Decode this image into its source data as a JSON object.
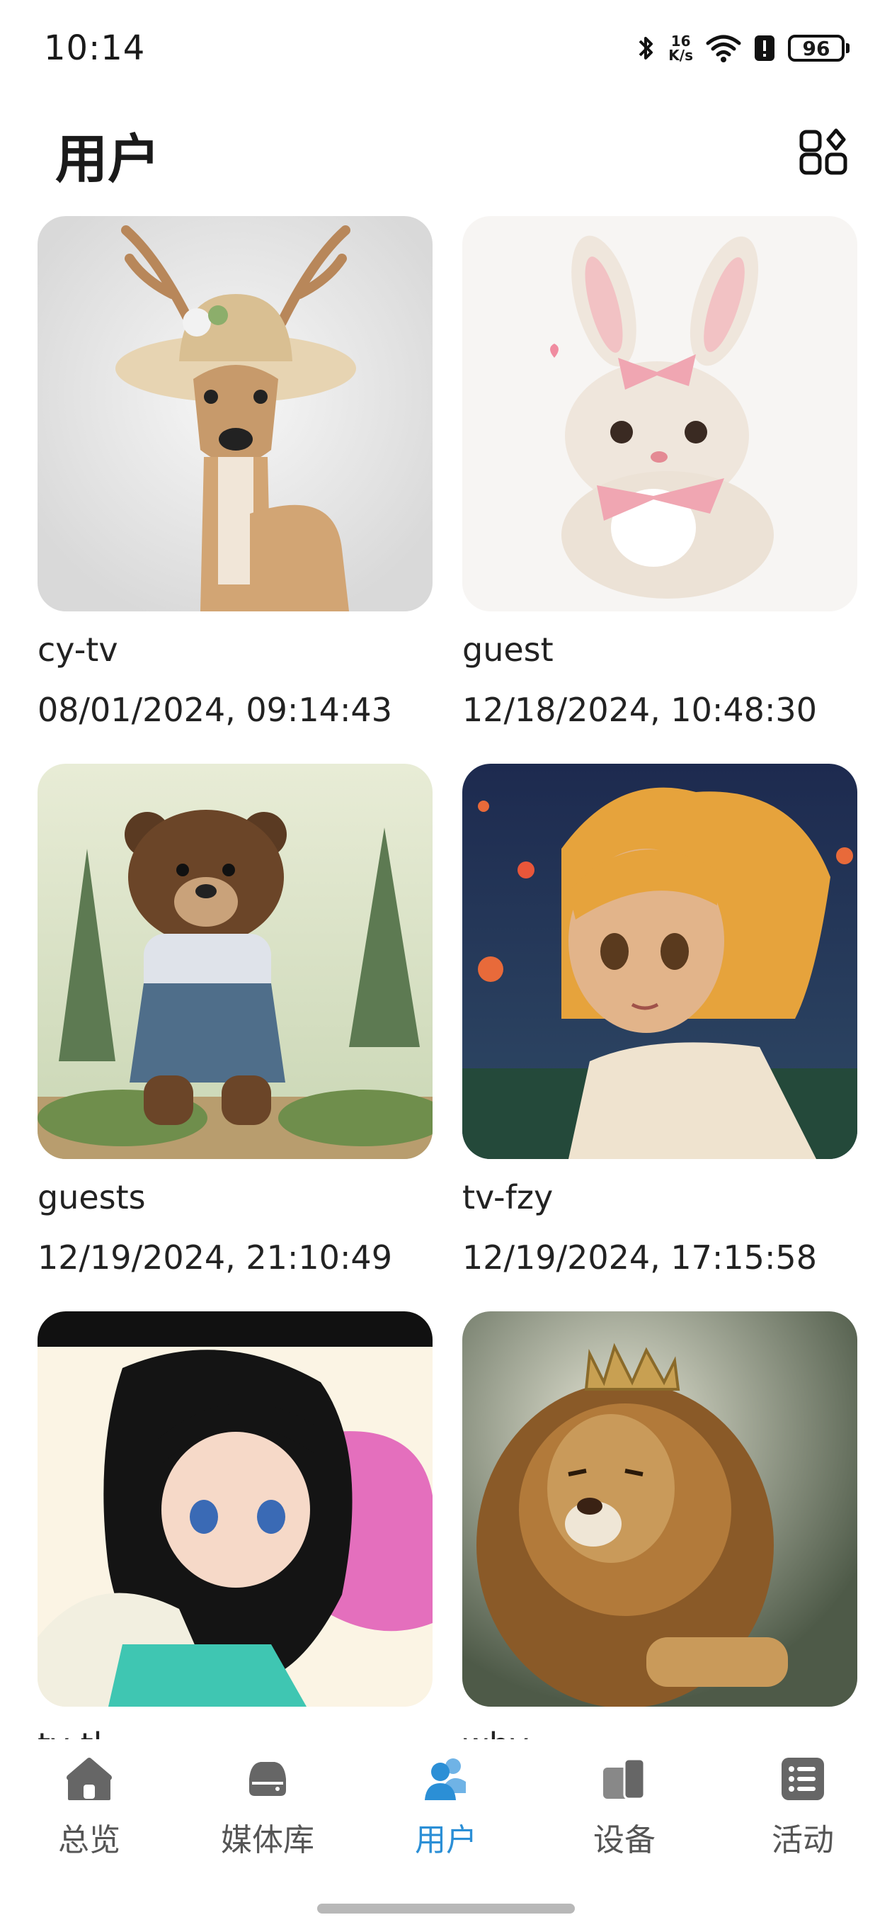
{
  "status_bar": {
    "time": "10:14",
    "speed_value": "16",
    "speed_unit": "K/s",
    "battery": "96"
  },
  "header": {
    "title": "用户"
  },
  "users": [
    {
      "name": "cy-tv",
      "last_seen": "08/01/2024, 09:14:43",
      "avatar": "deer-with-hat"
    },
    {
      "name": "guest",
      "last_seen": "12/18/2024, 10:48:30",
      "avatar": "bunny-with-bow"
    },
    {
      "name": "guests",
      "last_seen": "12/19/2024, 21:10:49",
      "avatar": "bear-in-overalls"
    },
    {
      "name": "tv-fzy",
      "last_seen": "12/19/2024, 17:15:58",
      "avatar": "anime-girl-orange-hair"
    },
    {
      "name": "tv-tl",
      "last_seen": "",
      "avatar": "anime-girl-black-hair"
    },
    {
      "name": "why",
      "last_seen": "",
      "avatar": "lion-with-crown"
    }
  ],
  "bottom_nav": [
    {
      "label": "总览",
      "icon": "home-icon"
    },
    {
      "label": "媒体库",
      "icon": "media-library-icon"
    },
    {
      "label": "用户",
      "icon": "users-icon",
      "active": true
    },
    {
      "label": "设备",
      "icon": "devices-icon"
    },
    {
      "label": "活动",
      "icon": "activity-icon"
    }
  ],
  "colors": {
    "accent": "#2b8fd6",
    "nav_inactive": "#555555"
  }
}
